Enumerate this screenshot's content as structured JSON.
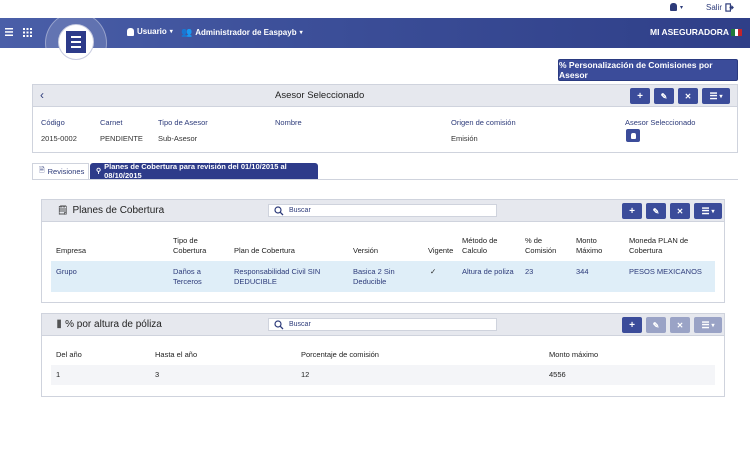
{
  "topbar": {
    "user_icon": "user-silhouette-icon",
    "logout_label": "Salir"
  },
  "navbar": {
    "user_menu": "Usuario",
    "admin_menu": "Administrador de Easpayb",
    "company": "MI ASEGURADORA"
  },
  "personalize_button": "% Personalización de Comisiones por Asesor",
  "asesor_card": {
    "title": "Asesor Seleccionado",
    "fields": {
      "codigo_label": "Código",
      "codigo_value": "2015-0002",
      "carnet_label": "Carnet",
      "carnet_value": "PENDIENTE",
      "tipo_label": "Tipo de Asesor",
      "tipo_value": "Sub-Asesor",
      "nombre_label": "Nombre",
      "origen_label": "Origen de comisión",
      "origen_value": "Emisión",
      "asesor_sel_label": "Asesor Seleccionado"
    }
  },
  "tabs": {
    "revisiones": "Revisiones",
    "planes": "Planes de Cobertura para revisión del 01/10/2015 al 08/10/2015"
  },
  "planes_card": {
    "title": "Planes de Cobertura",
    "search_placeholder": "Buscar",
    "headers": {
      "empresa": "Empresa",
      "tipo1": "Tipo de",
      "tipo2": "Cobertura",
      "plan": "Plan de Cobertura",
      "version": "Versión",
      "vigente": "Vigente",
      "metodo1": "Método de",
      "metodo2": "Calculo",
      "comision1": "% de",
      "comision2": "Comisión",
      "monto1": "Monto",
      "monto2": "Máximo",
      "moneda1": "Moneda PLAN de",
      "moneda2": "Cobertura"
    },
    "row": {
      "empresa": "Grupo",
      "tipo1": "Daños a",
      "tipo2": "Terceros",
      "plan1": "Responsabilidad Civil SIN",
      "plan2": "DEDUCIBLE",
      "version1": "Basica 2 Sin",
      "version2": "Deducible",
      "vigente": "✓",
      "metodo": "Altura de poliza",
      "comision": "23",
      "monto": "344",
      "moneda": "PESOS MEXICANOS"
    }
  },
  "altura_card": {
    "title": "% por altura de póliza",
    "search_placeholder": "Buscar",
    "headers": {
      "del": "Del año",
      "hasta": "Hasta el año",
      "porcentaje": "Porcentaje de comisión",
      "monto": "Monto máximo"
    },
    "row": {
      "del": "1",
      "hasta": "3",
      "porcentaje": "12",
      "monto": "4556"
    }
  }
}
